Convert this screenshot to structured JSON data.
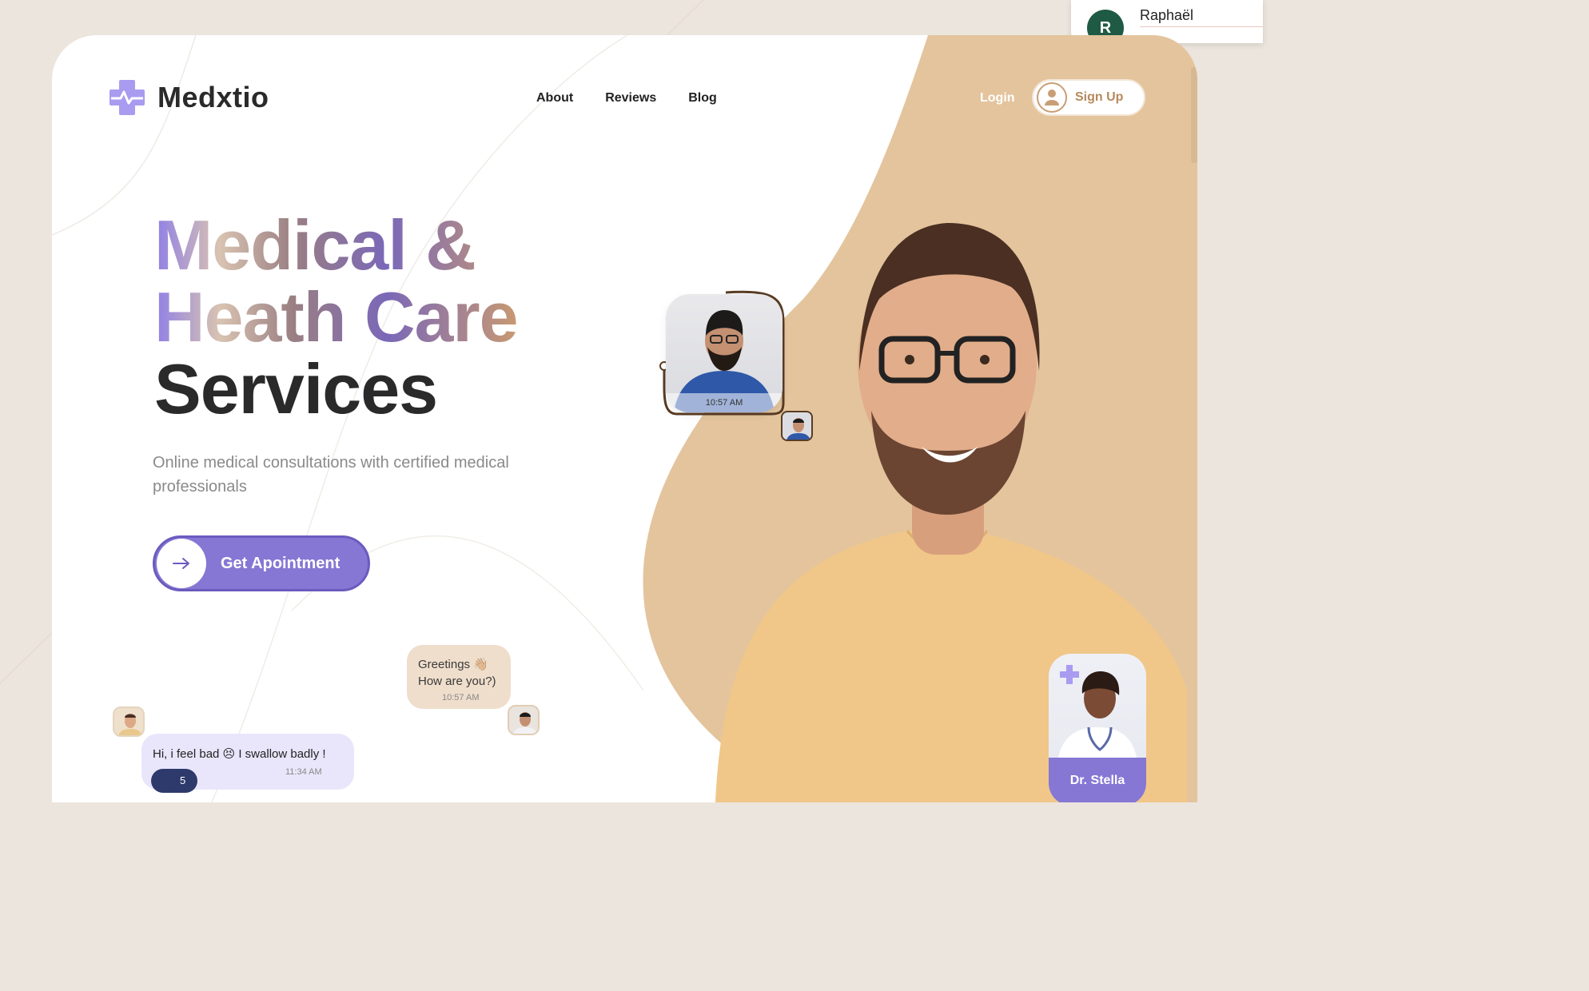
{
  "user": {
    "initial": "R",
    "name": "Raphaël"
  },
  "brand": {
    "name": "Medxtio",
    "accent": "#8677d4",
    "tan": "#e3c49d"
  },
  "nav": {
    "items": [
      "About",
      "Reviews",
      "Blog"
    ],
    "login": "Login",
    "signup": "Sign Up"
  },
  "hero": {
    "title_line1": "Medical &",
    "title_line2": "Heath Care",
    "title_line3": "Services",
    "subtitle": "Online medical consultations with certified medical professionals",
    "cta": "Get Apointment"
  },
  "doctor_bubble": {
    "time": "10:57 AM"
  },
  "greeting": {
    "line1": "Greetings 👋🏼",
    "line2": "How are you?)",
    "time": "10:57 AM"
  },
  "patient_message": {
    "text": "Hi, i feel bad 😣 I swallow badly !",
    "time": "11:34 AM",
    "reaction": "5"
  },
  "stella": {
    "name": "Dr. Stella"
  }
}
